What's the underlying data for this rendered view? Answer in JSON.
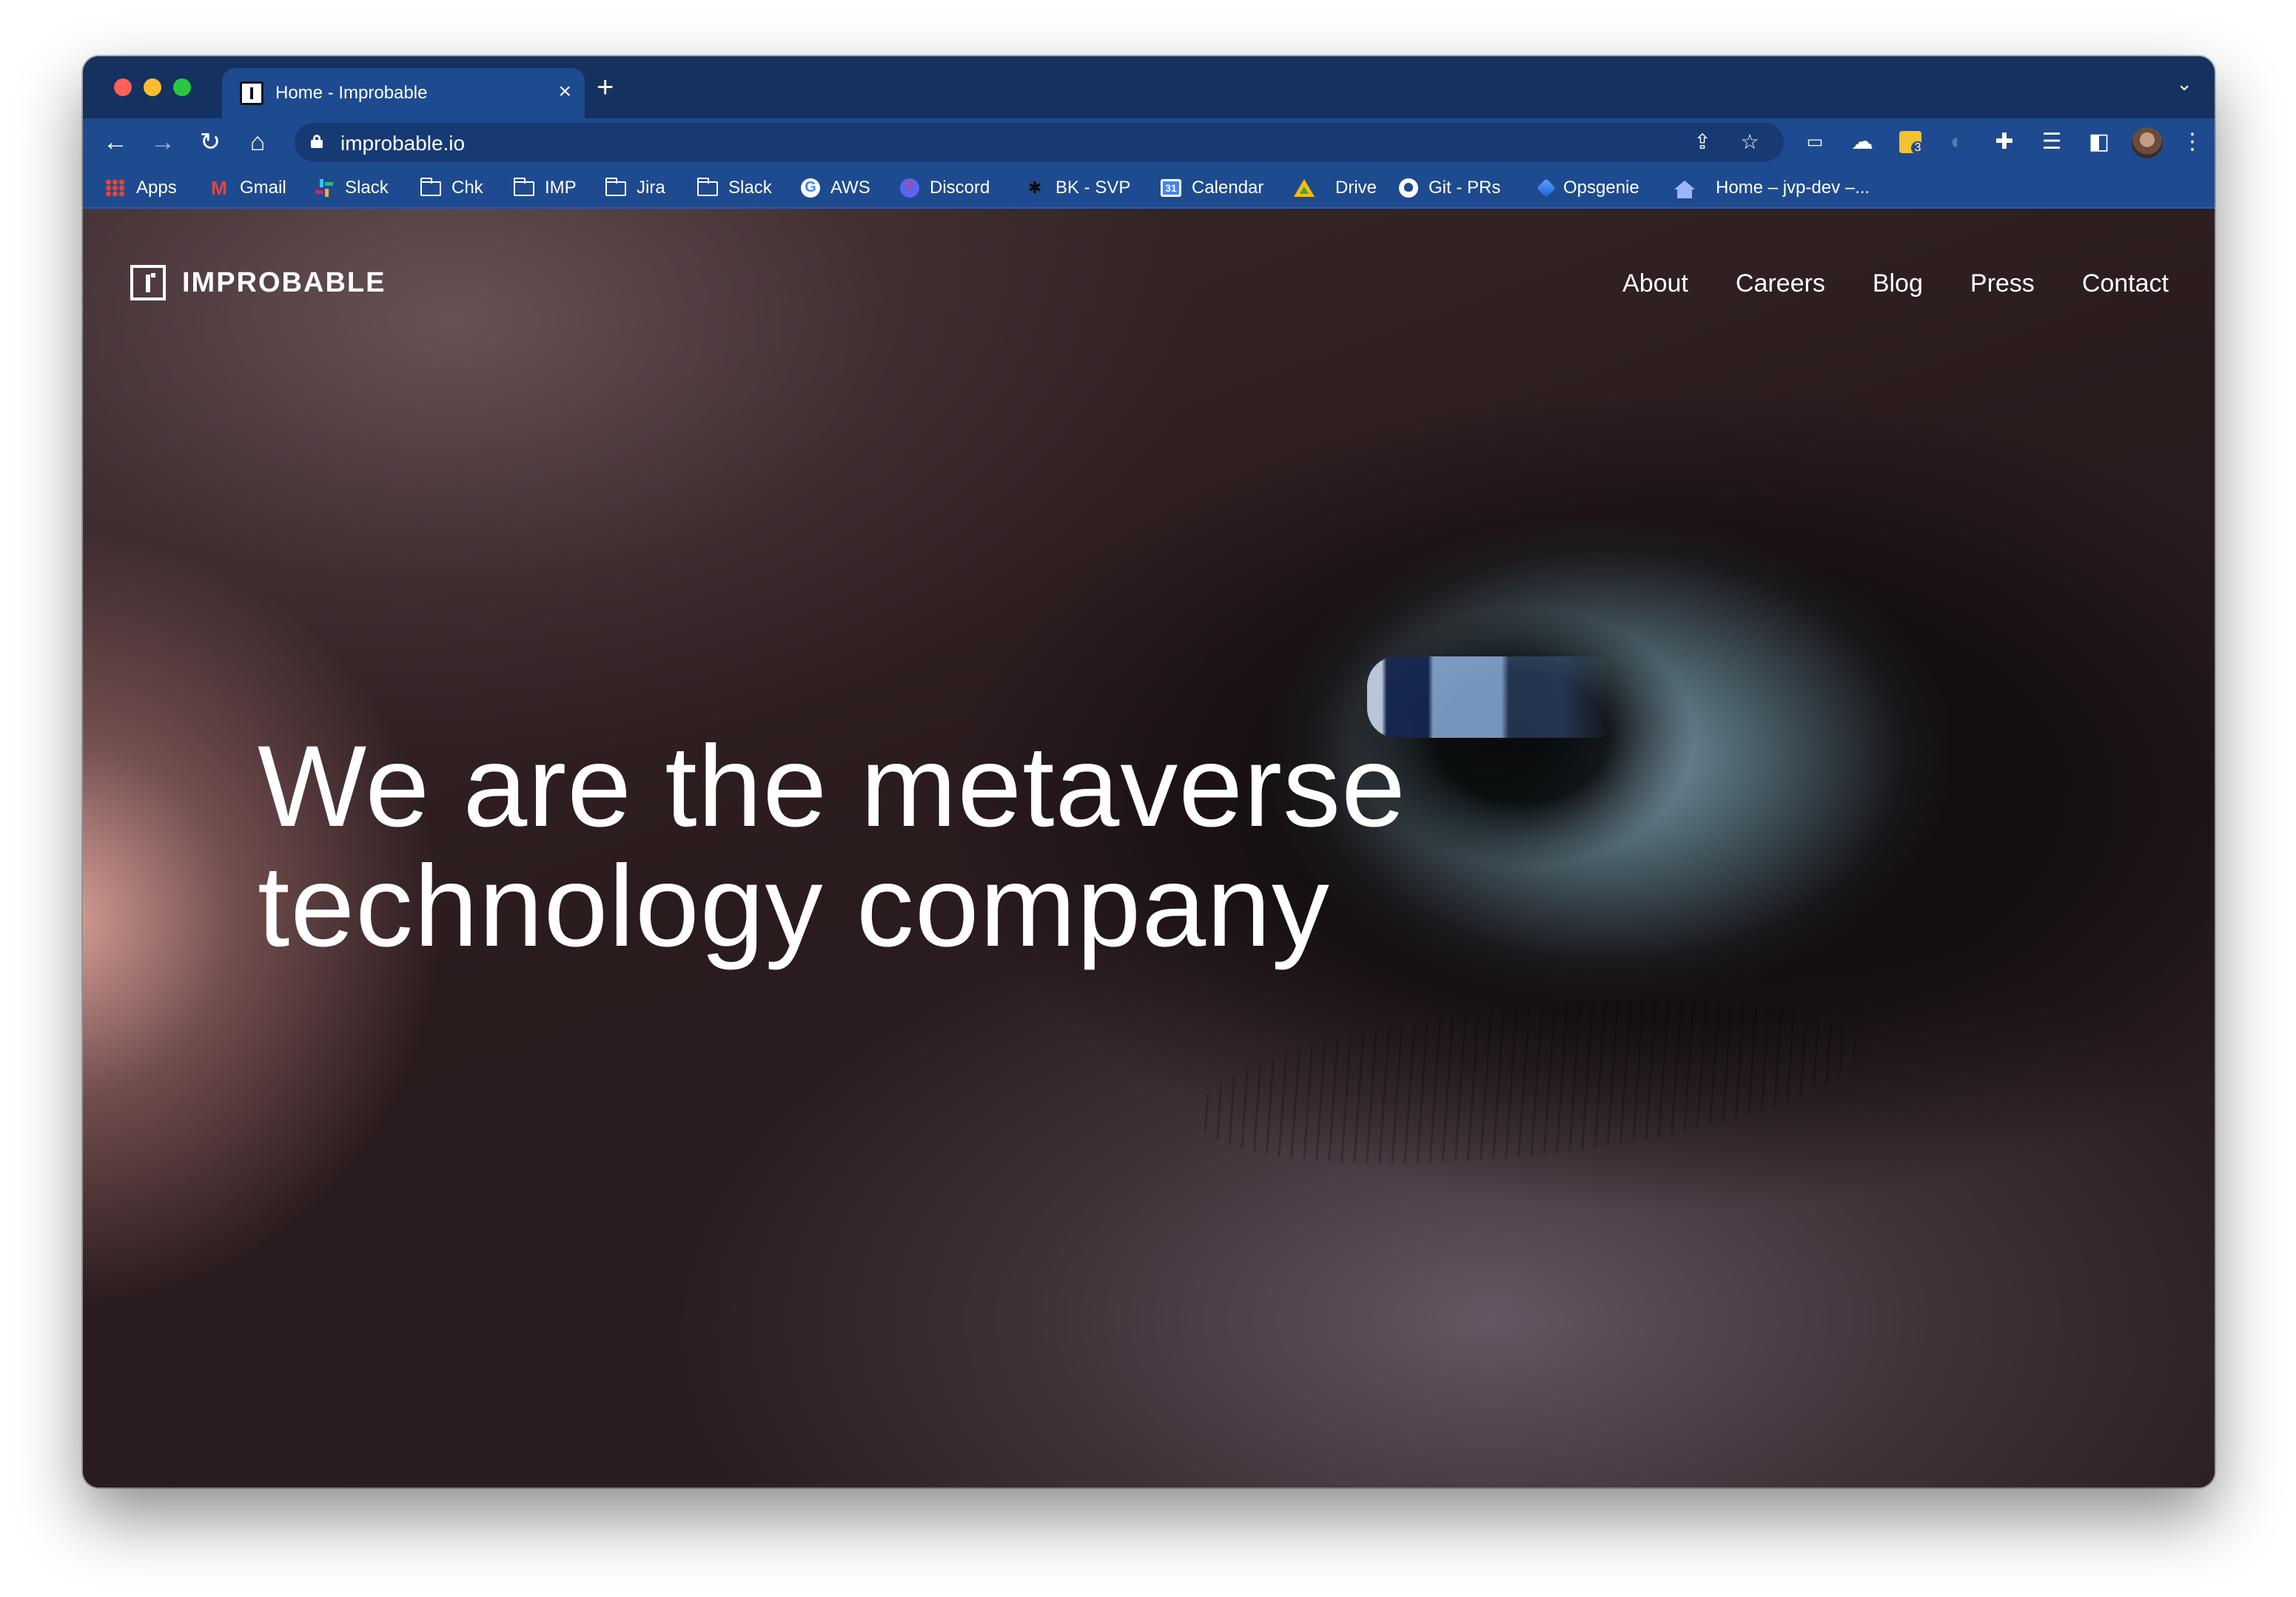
{
  "browser": {
    "tab": {
      "title": "Home - Improbable",
      "close_glyph": "×"
    },
    "new_tab_glyph": "+",
    "tab_list_glyph": "⌄",
    "nav": {
      "back_glyph": "←",
      "forward_glyph": "→",
      "reload_glyph": "↻",
      "home_glyph": "⌂"
    },
    "address": {
      "url": "improbable.io"
    },
    "extension_badge": "3",
    "bookmarks": [
      {
        "label": "Apps",
        "icon": "apps-grid-icon"
      },
      {
        "label": "Gmail",
        "icon": "gmail-icon"
      },
      {
        "label": "Slack",
        "icon": "slack-icon"
      },
      {
        "label": "Chk",
        "icon": "folder-icon"
      },
      {
        "label": "IMP",
        "icon": "folder-icon"
      },
      {
        "label": "Jira",
        "icon": "folder-icon"
      },
      {
        "label": "Slack",
        "icon": "folder-icon"
      },
      {
        "label": "AWS",
        "icon": "google-icon"
      },
      {
        "label": "Discord",
        "icon": "discord-icon"
      },
      {
        "label": "BK - SVP",
        "icon": "bk-icon"
      },
      {
        "label": "Calendar",
        "icon": "calendar-icon"
      },
      {
        "label": "Drive",
        "icon": "drive-icon"
      },
      {
        "label": "Git - PRs",
        "icon": "github-icon"
      },
      {
        "label": "Opsgenie",
        "icon": "opsgenie-icon"
      },
      {
        "label": "Home – jvp-dev –...",
        "icon": "home-icon"
      }
    ]
  },
  "site": {
    "logo_text": "IMPROBABLE",
    "nav": [
      "About",
      "Careers",
      "Blog",
      "Press",
      "Contact"
    ],
    "headline_line1": "We are the metaverse",
    "headline_line2": "technology company"
  },
  "colors": {
    "browser_chrome": "#1e4b8f",
    "tab_strip": "#14315f",
    "text": "#ffffff"
  }
}
